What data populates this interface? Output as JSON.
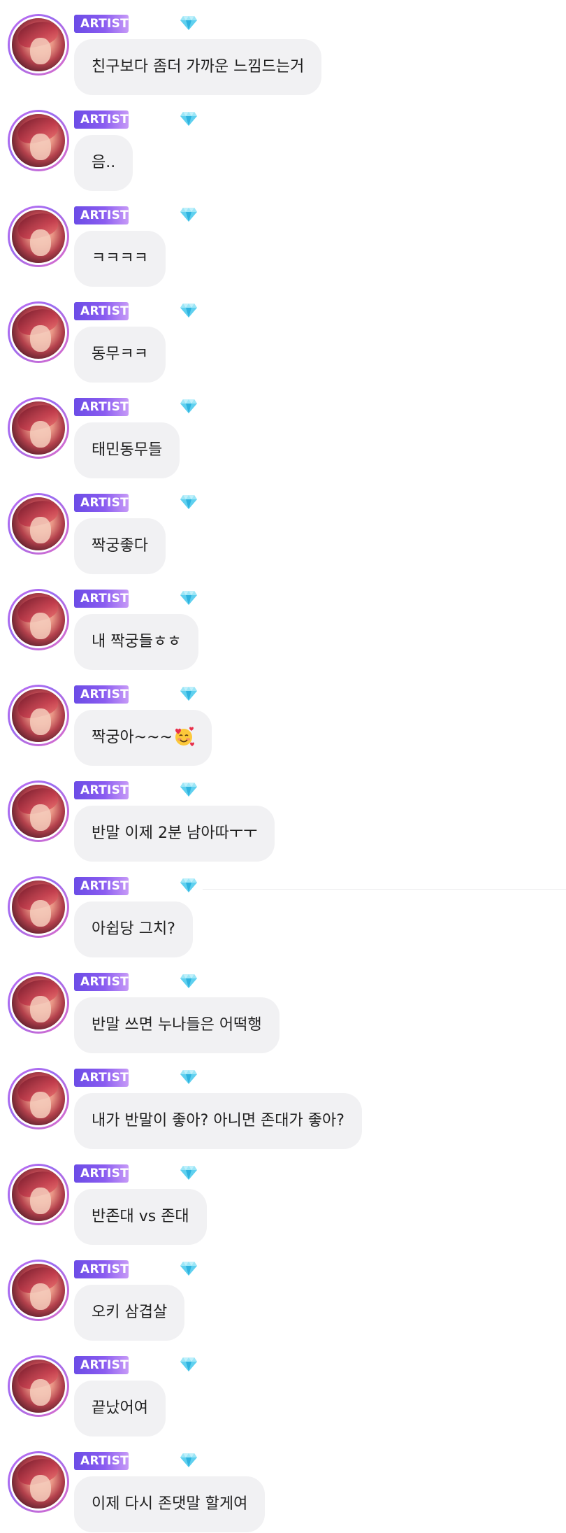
{
  "badge_label": "ARTIST",
  "colors": {
    "badge_start": "#6b4ce6",
    "badge_end": "#c79af7",
    "bubble_bg": "#f1f1f3",
    "text": "#1f1f1f",
    "gem": "#5fd0ef"
  },
  "icons": {
    "badge_gem": "diamond-gem-icon",
    "emoji": "smiling-face-with-hearts-emoji"
  },
  "messages": [
    {
      "text": "친구보다 좀더 가까운 느낌드는거"
    },
    {
      "text": "음.."
    },
    {
      "text": "ㅋㅋㅋㅋ"
    },
    {
      "text": "동무ㅋㅋ"
    },
    {
      "text": "태민동무들"
    },
    {
      "text": "짝궁좋다"
    },
    {
      "text": "내 짝궁들ㅎㅎ"
    },
    {
      "text": "짝궁아~~~"
    },
    {
      "text": "반말 이제 2분 남아따ㅜㅜ"
    },
    {
      "text": "아쉽당 그치?"
    },
    {
      "text": "반말 쓰면 누나들은 어떡행"
    },
    {
      "text": "내가 반말이 좋아? 아니면 존대가 좋아?"
    },
    {
      "text": "반존대 vs 존대"
    },
    {
      "text": "오키 삼겹살"
    },
    {
      "text": "끝났어여"
    },
    {
      "text": "이제 다시 존댓말 할게여"
    }
  ]
}
